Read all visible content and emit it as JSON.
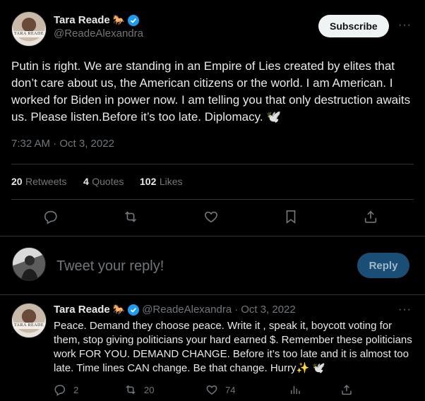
{
  "main_tweet": {
    "author_name": "Tara Reade",
    "author_emoji": "🐎",
    "handle": "@ReadeAlexandra",
    "avatar_caption": "TARA READE",
    "subscribe_label": "Subscribe",
    "more_label": "···",
    "text": "Putin is right. We are standing in an Empire of Lies created by elites that don’t care about us, the American citizens or the world. I am American. I worked for Biden in power now. I am telling you that only destruction awaits us. Please listen.Before it’s too late. Diplomacy. 🕊️",
    "timestamp": "7:32 AM · Oct 3, 2022",
    "stats": {
      "retweets_count": "20",
      "retweets_label": "Retweets",
      "quotes_count": "4",
      "quotes_label": "Quotes",
      "likes_count": "102",
      "likes_label": "Likes"
    }
  },
  "reply_composer": {
    "placeholder": "Tweet your reply!",
    "button_label": "Reply"
  },
  "reply_tweet": {
    "author_name": "Tara Reade",
    "author_emoji": "🐎",
    "handle": "@ReadeAlexandra",
    "separator": "·",
    "date": "Oct 3, 2022",
    "avatar_caption": "TARA READE",
    "more_label": "···",
    "text": "Peace. Demand they choose peace. Write it , speak it, boycott voting for them, stop giving politicians your hard earned $. Remember these politicians work FOR YOU. DEMAND CHANGE. Before it’s too late and it is almost too late. Time lines  CAN change. Be that change. Hurry✨ 🕊️",
    "actions": {
      "replies": "2",
      "retweets": "20",
      "likes": "74"
    }
  },
  "colors": {
    "background": "#000000",
    "text": "#e7e9ea",
    "muted": "#71767b",
    "verified": "#1d9bf0",
    "divider": "#2f3336"
  }
}
